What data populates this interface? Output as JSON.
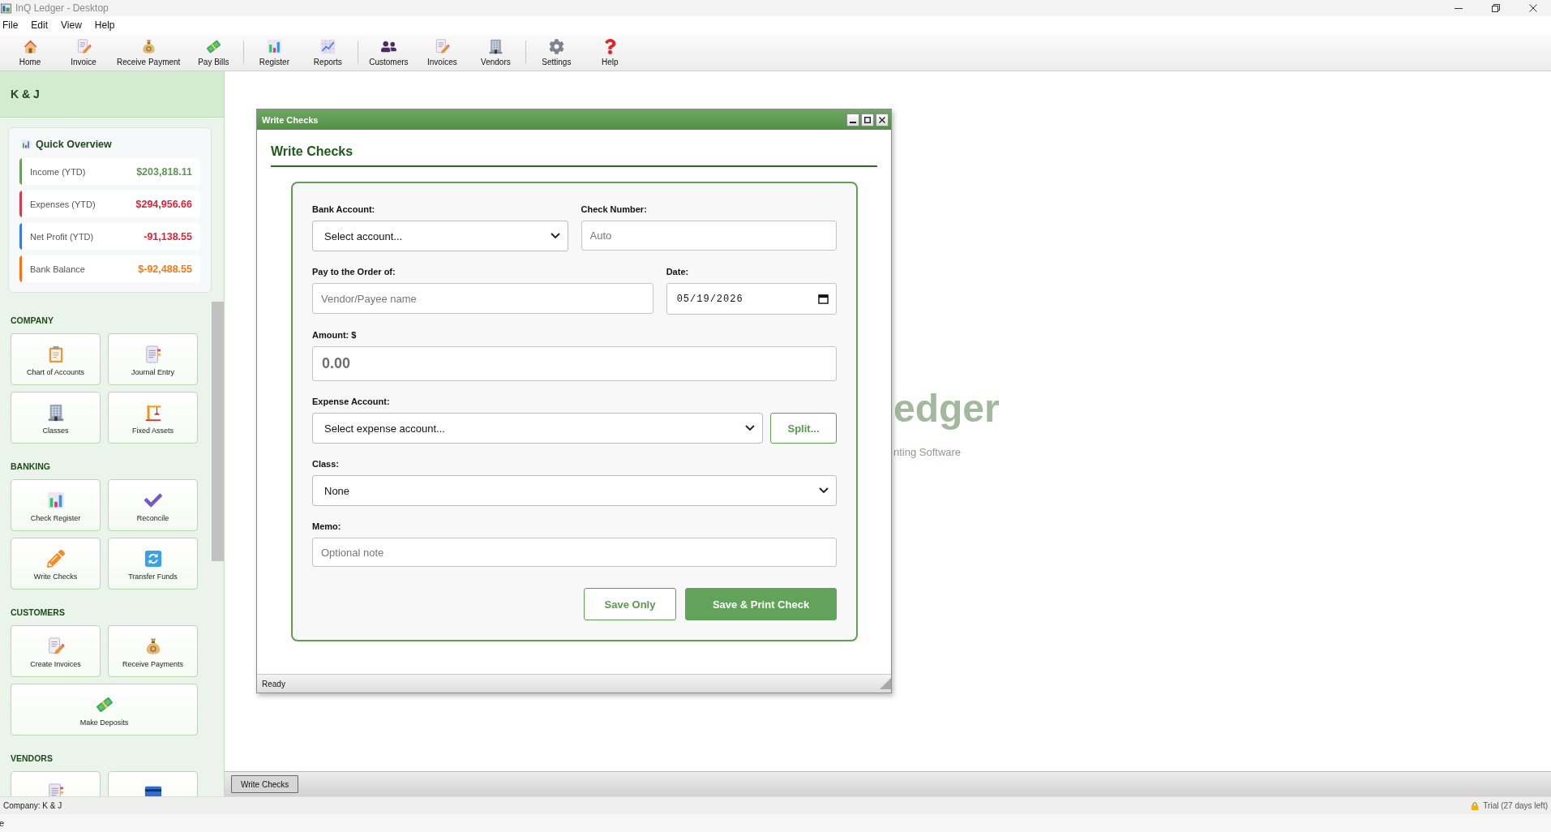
{
  "window": {
    "title": "InQ Ledger - Desktop"
  },
  "menu_bar": [
    "File",
    "Edit",
    "View",
    "Help"
  ],
  "toolbar": [
    [
      "Home",
      "Invoice",
      "Receive Payment",
      "Pay Bills"
    ],
    [
      "Register",
      "Reports"
    ],
    [
      "Customers",
      "Invoices",
      "Vendors"
    ],
    [
      "Settings",
      "Help"
    ]
  ],
  "sidebar": {
    "company_name": "K & J",
    "quick_overview": {
      "title": "Quick Overview",
      "rows": [
        {
          "label": "Income (YTD)",
          "value": "$203,818.11",
          "color": "#6aa05a",
          "kind": "gain"
        },
        {
          "label": "Expenses (YTD)",
          "value": "$294,956.66",
          "color": "#d9394d",
          "kind": "loss"
        },
        {
          "label": "Net Profit (YTD)",
          "value": "-91,138.55",
          "color": "#3478f6",
          "kind": "loss"
        },
        {
          "label": "Bank Balance",
          "value": "$-92,488.55",
          "color": "#fd7014",
          "kind": "warning"
        }
      ]
    },
    "sections": [
      {
        "heading": "COMPANY",
        "tiles": [
          {
            "kind": "labeled",
            "label": "Chart of Accounts"
          },
          {
            "kind": "labeled",
            "label": "Journal Entry"
          },
          {
            "kind": "labeled",
            "label": "Classes"
          },
          {
            "kind": "labeled",
            "label": "Fixed Assets"
          }
        ]
      },
      {
        "heading": "BANKING",
        "tiles": [
          {
            "kind": "labeled",
            "label": "Check Register"
          },
          {
            "kind": "labeled",
            "label": "Reconcile"
          },
          {
            "kind": "labeled",
            "label": "Write Checks"
          },
          {
            "kind": "labeled",
            "label": "Transfer Funds"
          }
        ]
      },
      {
        "heading": "CUSTOMERS",
        "tiles": [
          {
            "kind": "labeled",
            "label": "Create Invoices"
          },
          {
            "kind": "labeled",
            "label": "Receive Payments"
          },
          {
            "kind": "labeled",
            "label": "Make Deposits"
          }
        ]
      },
      {
        "heading": "VENDORS",
        "tiles": [
          {
            "kind": "clipped"
          },
          {
            "kind": "clipped"
          }
        ]
      }
    ]
  },
  "dialog": {
    "title": "Write Checks",
    "heading": "Write Checks",
    "form": {
      "bank_account": {
        "label": "Bank Account:",
        "value": "Select account..."
      },
      "check_number": {
        "label": "Check Number:",
        "placeholder": "Auto"
      },
      "payee": {
        "label": "Pay to the Order of:",
        "placeholder": "Vendor/Payee name"
      },
      "date": {
        "label": "Date:",
        "value": "05/19/2026"
      },
      "amount": {
        "label": "Amount: $",
        "placeholder": "0.00"
      },
      "expense_account": {
        "label": "Expense Account:",
        "value": "Select expense account...",
        "button": "Split..."
      },
      "class": {
        "label": "Class:",
        "value": "None"
      },
      "memo": {
        "label": "Memo:",
        "placeholder": "Optional note"
      }
    },
    "buttons": [
      {
        "label": "Save Only",
        "kind": "secondary"
      },
      {
        "label": "Save & Print Check",
        "kind": "primary"
      }
    ],
    "status": "Ready"
  },
  "background_logo": {
    "title": "edger",
    "subtitle": "nting Software"
  },
  "taskbar": [
    "Write Checks"
  ],
  "status_bar": {
    "company": "Company: K & J",
    "trial": "Trial (27 days left)"
  },
  "bottom_strip": {
    "text": "e"
  }
}
